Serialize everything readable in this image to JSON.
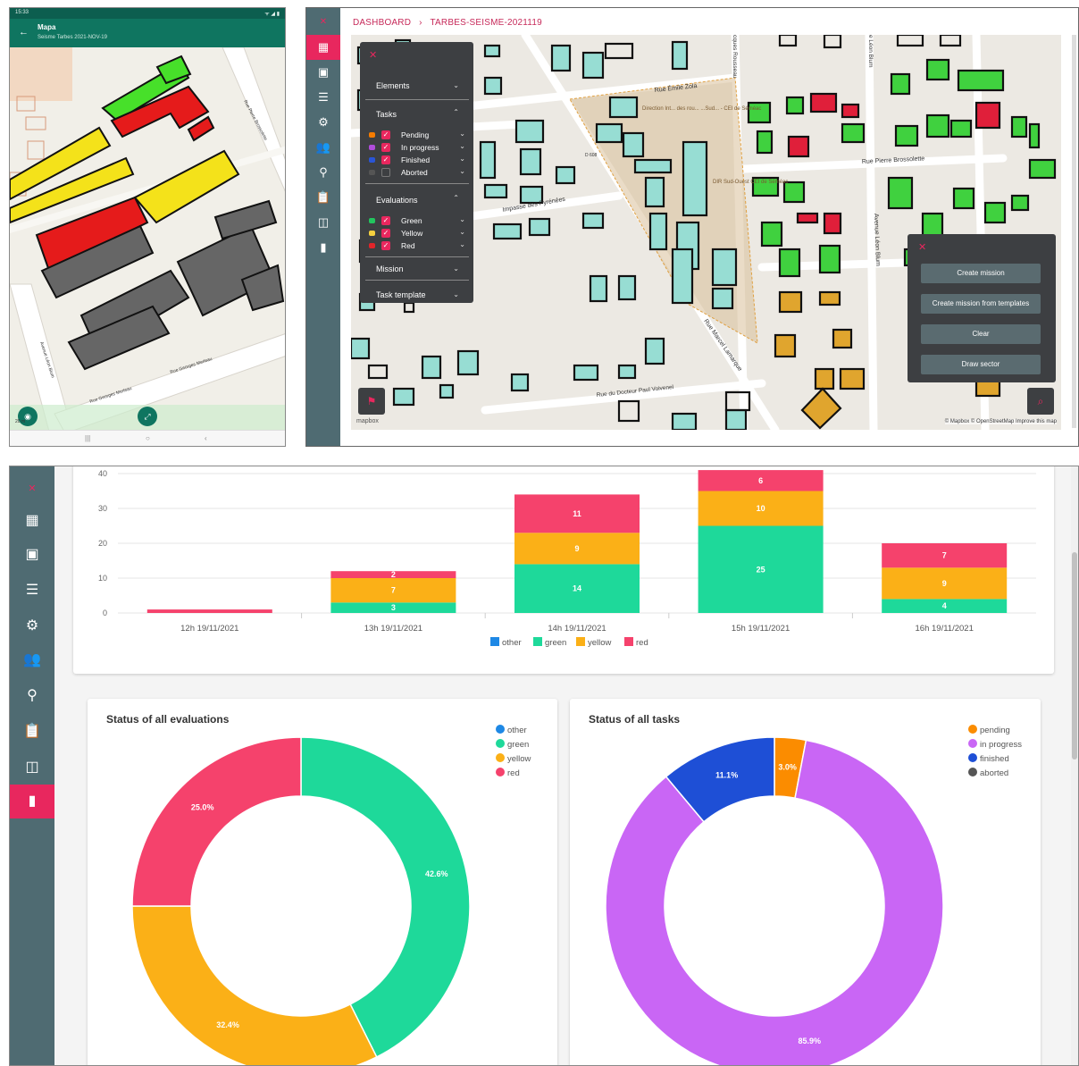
{
  "phone": {
    "status_time": "15:33",
    "status_icons": "ᯤ ◢ ▮",
    "back_icon": "arrow-back-icon",
    "title": "Mapa",
    "subtitle": "Seisme Tarbes 2021-NOV-19",
    "street_labels": [
      "Rue Georges Merleau",
      "Rue Georges Merleau",
      "Avenue Léon Blum",
      "Rue Pierre Brossolette"
    ],
    "scale_label": "20 m",
    "nav_buttons": [
      "|||",
      "○",
      "‹"
    ]
  },
  "webmap": {
    "breadcrumb": [
      "DASHBOARD",
      "TARBES-SEISME-2021119"
    ],
    "breadcrumb_separator": "›",
    "layer_panel": {
      "close": "✕",
      "elements_label": "Elements",
      "tasks_label": "Tasks",
      "tasks": [
        {
          "label": "Pending",
          "color": "#f57c00",
          "checked": true
        },
        {
          "label": "In progress",
          "color": "#b04ddb",
          "checked": true
        },
        {
          "label": "Finished",
          "color": "#2a55d6",
          "checked": true
        },
        {
          "label": "Aborted",
          "color": "#555555",
          "checked": false
        }
      ],
      "evaluations_label": "Evaluations",
      "evaluations": [
        {
          "label": "Green",
          "color": "#22c55e",
          "checked": true
        },
        {
          "label": "Yellow",
          "color": "#f4d03f",
          "checked": true
        },
        {
          "label": "Red",
          "color": "#e0252a",
          "checked": true
        }
      ],
      "mission_label": "Mission",
      "task_template_label": "Task template"
    },
    "action_panel": {
      "close": "✕",
      "buttons": [
        "Create mission",
        "Create mission from templates",
        "Clear",
        "Draw sector"
      ]
    },
    "map_labels": {
      "rue_emile_zola": "Rue Émile Zola",
      "impasse": "Impasse des Pyrénées",
      "rue_pierre": "Rue Pierre Brossolette",
      "avenue_leon_blum": "Avenue Léon Blum",
      "rue_marcel": "Rue Marcel Lamarque",
      "rue_docteur": "Rue du Docteur Paul Voivenel",
      "rousseau": "cques Rousseau",
      "leon_blum_top": "e Léon Blum",
      "direction": "Direction Int... des rou... ...Sud... - CEI de Séméac",
      "dir_sud_ouest": "DIR Sud-Ouest CEI de Séméac",
      "d608": "D 608"
    },
    "attribution": "© Mapbox © OpenStreetMap Improve this map",
    "logo": "mapbox"
  },
  "dashboard": {
    "rail_icons": [
      "dashboard-icon",
      "calendar-icon",
      "list-icon",
      "gear-icon",
      "people-icon",
      "location-pin-icon",
      "clipboard-icon",
      "compare-icon",
      "bar-chart-icon"
    ],
    "eval_title": "Status of all evaluations",
    "task_title": "Status of all tasks"
  },
  "chart_data": [
    {
      "type": "bar",
      "stacked": true,
      "categories": [
        "12h 19/11/2021",
        "13h 19/11/2021",
        "14h 19/11/2021",
        "15h 19/11/2021",
        "16h 19/11/2021"
      ],
      "series": [
        {
          "name": "other",
          "color": "#1e88e5",
          "values": [
            0,
            0,
            0,
            0,
            0
          ]
        },
        {
          "name": "green",
          "color": "#1ed99a",
          "values": [
            0,
            3,
            14,
            25,
            4
          ]
        },
        {
          "name": "yellow",
          "color": "#fbb017",
          "values": [
            0,
            7,
            9,
            10,
            9
          ]
        },
        {
          "name": "red",
          "color": "#f5426c",
          "values": [
            1,
            2,
            11,
            6,
            7
          ]
        }
      ],
      "data_labels": [
        [
          null,
          null,
          null,
          null
        ],
        [
          null,
          "3",
          "7",
          "2"
        ],
        [
          null,
          "14",
          "9",
          "11"
        ],
        [
          null,
          "25",
          "10",
          "6"
        ],
        [
          null,
          "4",
          "9",
          "7"
        ]
      ],
      "yticks": [
        0,
        10,
        20,
        30,
        40
      ],
      "ylim": [
        0,
        40
      ],
      "legend_position": "bottom"
    },
    {
      "type": "pie",
      "donut": true,
      "title": "Status of all evaluations",
      "labels": [
        "other",
        "green",
        "yellow",
        "red"
      ],
      "colors": [
        "#1e88e5",
        "#1ed99a",
        "#fbb017",
        "#f5426c"
      ],
      "values": [
        0,
        42.6,
        32.4,
        25.0
      ],
      "value_labels": [
        "",
        "42.6%",
        "32.4%",
        "25.0%"
      ],
      "legend_position": "top-right"
    },
    {
      "type": "pie",
      "donut": true,
      "title": "Status of all tasks",
      "labels": [
        "pending",
        "in progress",
        "finished",
        "aborted"
      ],
      "colors": [
        "#fb8c00",
        "#c966f5",
        "#1e4fd6",
        "#555555"
      ],
      "values": [
        3.0,
        85.9,
        11.1,
        0
      ],
      "value_labels": [
        "3.0%",
        "85.9%",
        "11.1%",
        ""
      ],
      "legend_position": "top-right"
    }
  ]
}
